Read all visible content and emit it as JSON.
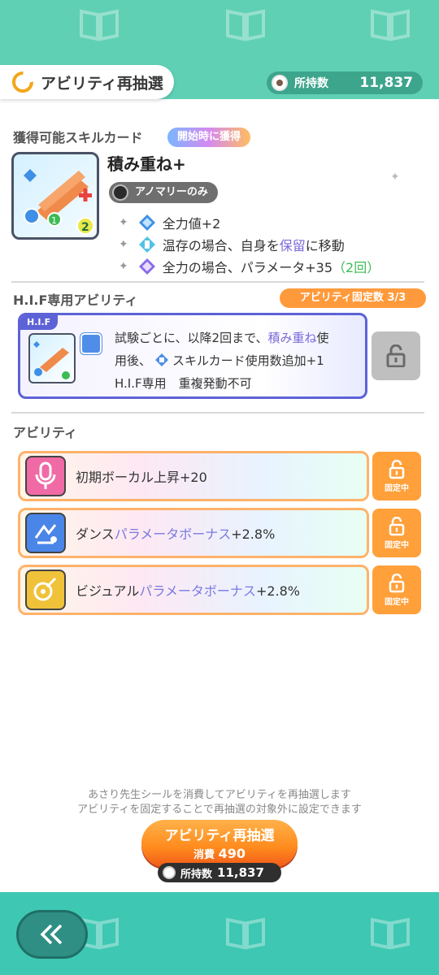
{
  "header": {
    "title": "アビリティ再抽選",
    "owned_label": "所持数",
    "owned_value": "11,837"
  },
  "skill_card": {
    "section_title": "獲得可能スキルカード",
    "badge": "開始時に獲得",
    "name": "積み重ね+",
    "restriction": "アノマリーのみ",
    "effects": [
      {
        "text_a": "全力値+2",
        "icon": "fullpower-icon"
      },
      {
        "text_a": "温存の場合、自身を",
        "highlight": "保留",
        "text_b": "に移動",
        "icon": "conserve-icon"
      },
      {
        "text_a": "全力の場合、パラメータ+35",
        "extra": "（2回）",
        "icon": "fullpower-stance-icon"
      }
    ]
  },
  "hif": {
    "section_title": "H.I.F専用アビリティ",
    "fixed_badge": "アビリティ固定数 3/3",
    "tag": "H.I.F",
    "line1_a": "試験ごとに、以降2回まで、",
    "line1_hl": "積み重ね",
    "line1_b": "使",
    "line2_a": "用後、",
    "line2_b": "スキルカード使用数追加+1",
    "line3": "H.I.F専用　重複発動不可"
  },
  "abilities": {
    "section_title": "アビリティ",
    "fixed_label": "固定中",
    "items": [
      {
        "a": "初期ボーカル上昇+20",
        "hl": "",
        "b": "",
        "icon": "vocal-mic-icon"
      },
      {
        "a": "ダンス",
        "hl": "パラメータボーナス",
        "b": "+2.8%",
        "icon": "dance-icon"
      },
      {
        "a": "ビジュアル",
        "hl": "パラメータボーナス",
        "b": "+2.8%",
        "icon": "visual-icon"
      }
    ]
  },
  "bottom": {
    "info_line1": "あさり先生シールを消費してアビリティを再抽選します",
    "info_line2": "アビリティを固定することで再抽選の対象外に設定できます",
    "button_label": "アビリティ再抽選",
    "cost_label": "消費",
    "cost_value": "490",
    "owned_label": "所持数",
    "owned_value": "11,837"
  },
  "colors": {
    "header_bg": "#5fd0b4",
    "accent_orange": "#ff9a3c",
    "hif_blue": "#5d62d6",
    "highlight_purple": "#7b69d8"
  }
}
